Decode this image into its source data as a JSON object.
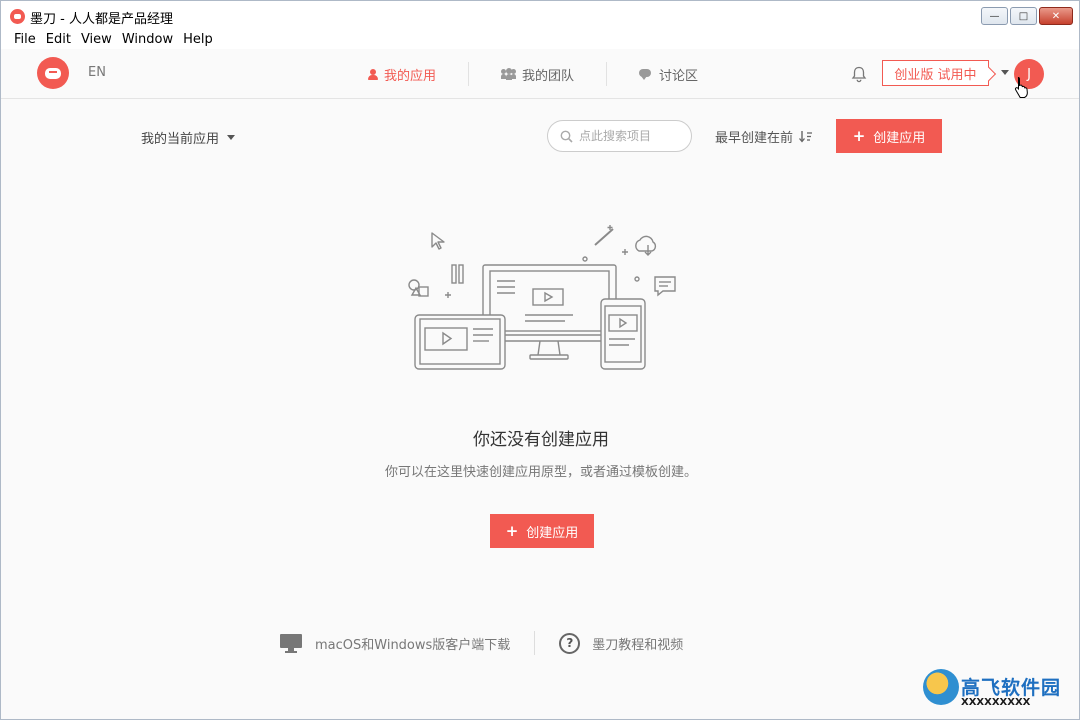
{
  "window": {
    "title": "墨刀 - 人人都是产品经理"
  },
  "menu": [
    "File",
    "Edit",
    "View",
    "Window",
    "Help"
  ],
  "header": {
    "lang": "EN",
    "nav": [
      {
        "label": "我的应用",
        "icon": "user-icon",
        "active": true
      },
      {
        "label": "我的团队",
        "icon": "team-icon",
        "active": false
      },
      {
        "label": "讨论区",
        "icon": "chat-icon",
        "active": false
      }
    ],
    "trial_label": "创业版 试用中",
    "avatar_initial": "J"
  },
  "toolbar": {
    "filter_label": "我的当前应用",
    "search_placeholder": "点此搜索项目",
    "sort_label": "最早创建在前",
    "create_label": "创建应用"
  },
  "empty": {
    "title": "你还没有创建应用",
    "subtitle": "你可以在这里快速创建应用原型，或者通过模板创建。",
    "create_label": "创建应用"
  },
  "footer": {
    "download_label": "macOS和Windows版客户端下载",
    "tutorial_label": "墨刀教程和视频"
  },
  "watermark": {
    "line1": "高飞软件园",
    "line2": "XXXXXXXXX"
  },
  "colors": {
    "accent": "#f25a52"
  }
}
